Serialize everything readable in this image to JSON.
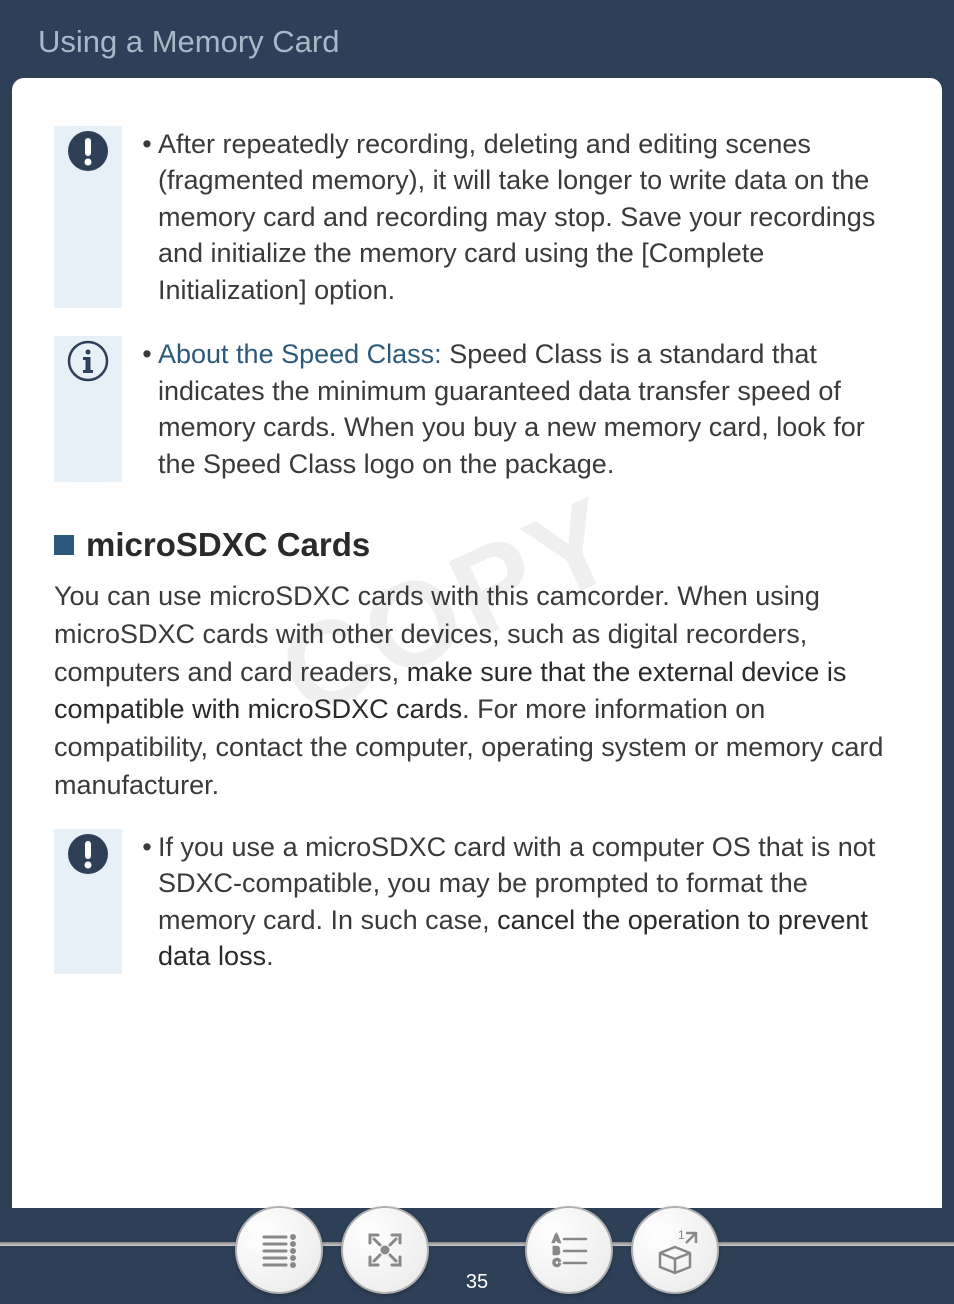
{
  "header": {
    "title": "Using a Memory Card"
  },
  "notes": {
    "warning1": {
      "bullet": "•",
      "text": "After repeatedly recording, deleting and editing scenes (fragmented memory), it will take longer to write data on the memory card and recording may stop. Save your recordings and initialize the memory card using the [Complete Initialization] option."
    },
    "info1": {
      "bullet": "•",
      "highlight": "About the Speed Class:",
      "text": " Speed Class is a standard that indicates the minimum guaranteed data transfer speed of memory cards. When you buy a new memory card, look for the Speed Class logo on the package."
    },
    "warning2": {
      "bullet": "•",
      "text_before": "If you use a microSDXC card with a computer OS that is not SDXC-compatible, you may be prompted to format the memory card. In such case, ",
      "strong": "cancel the operation to prevent data loss",
      "text_after": "."
    }
  },
  "section": {
    "title": "microSDXC Cards",
    "body_before": "You can use microSDXC cards with this camcorder. When using microSDXC cards with other devices, such as digital recorders, computers and card readers, ",
    "body_strong": "make sure that the external device is compatible with microSDXC cards",
    "body_after": ". For more information on compatibility, contact the computer, operating system or memory card manufacturer."
  },
  "watermark": "COPY",
  "page_number": "35"
}
